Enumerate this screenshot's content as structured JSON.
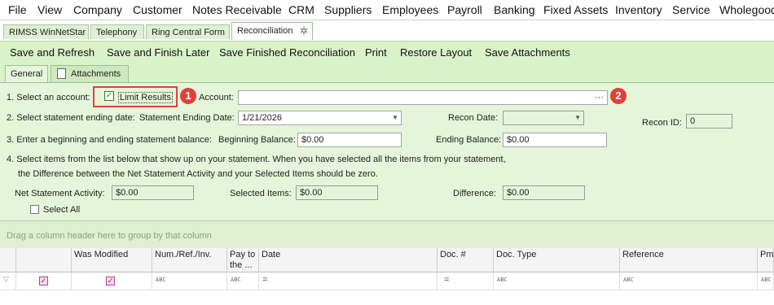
{
  "menu": [
    "File",
    "View",
    "Company",
    "Customer",
    "Notes Receivable",
    "CRM",
    "Suppliers",
    "Employees",
    "Payroll",
    "Banking",
    "Fixed Assets",
    "Inventory",
    "Service",
    "Wholegood"
  ],
  "doc_tabs": [
    "RIMSS WinNetStar",
    "Telephony",
    "Ring Central Form",
    "Reconciliation"
  ],
  "toolbar": [
    "Save and Refresh",
    "Save and Finish Later",
    "Save Finished Reconciliation",
    "Print",
    "Restore Layout",
    "Save Attachments"
  ],
  "inner_tabs": [
    "General",
    "Attachments"
  ],
  "form": {
    "step1": "1. Select an account:",
    "limit_results": "Limit Results",
    "account_label": "Account:",
    "account_value": "",
    "account_browse": "···",
    "step2": "2. Select statement ending date:",
    "stmt_end_label": "Statement Ending Date:",
    "stmt_end_value": "1/21/2026",
    "recon_date_label": "Recon Date:",
    "recon_date_value": "",
    "recon_id_label": "Recon ID:",
    "recon_id_value": "0",
    "step3": "3. Enter a beginning and ending statement balance:",
    "begin_label": "Beginning Balance:",
    "begin_value": "$0.00",
    "end_label": "Ending Balance:",
    "end_value": "$0.00",
    "step4_line1": "4. Select items from the list below that show up on your statement. When you have selected all the items from your statement,",
    "step4_line2": "the Difference between the Net Statement Activity and your Selected Items should be zero.",
    "net_label": "Net Statement Activity:",
    "net_value": "$0.00",
    "selected_label": "Selected Items:",
    "selected_value": "$0.00",
    "diff_label": "Difference:",
    "diff_value": "$0.00",
    "select_all": "Select All"
  },
  "callouts": [
    "1",
    "2"
  ],
  "group_hint": "Drag a column header here to group by that column",
  "grid": {
    "columns": [
      "",
      "",
      "Was Modified",
      "Num./Ref./Inv.",
      "Pay to the ...",
      "Date",
      "Doc. #",
      "Doc. Type",
      "Reference",
      "Pmt"
    ],
    "filter_row": [
      "",
      "",
      "",
      "ABC",
      "ABC",
      "=",
      "=",
      "ABC",
      "ABC",
      "ABC"
    ]
  },
  "colors": {
    "accent_red": "#e0403a",
    "panel_green": "#e4f5d9",
    "toolbar_green": "#d9f2c8"
  }
}
